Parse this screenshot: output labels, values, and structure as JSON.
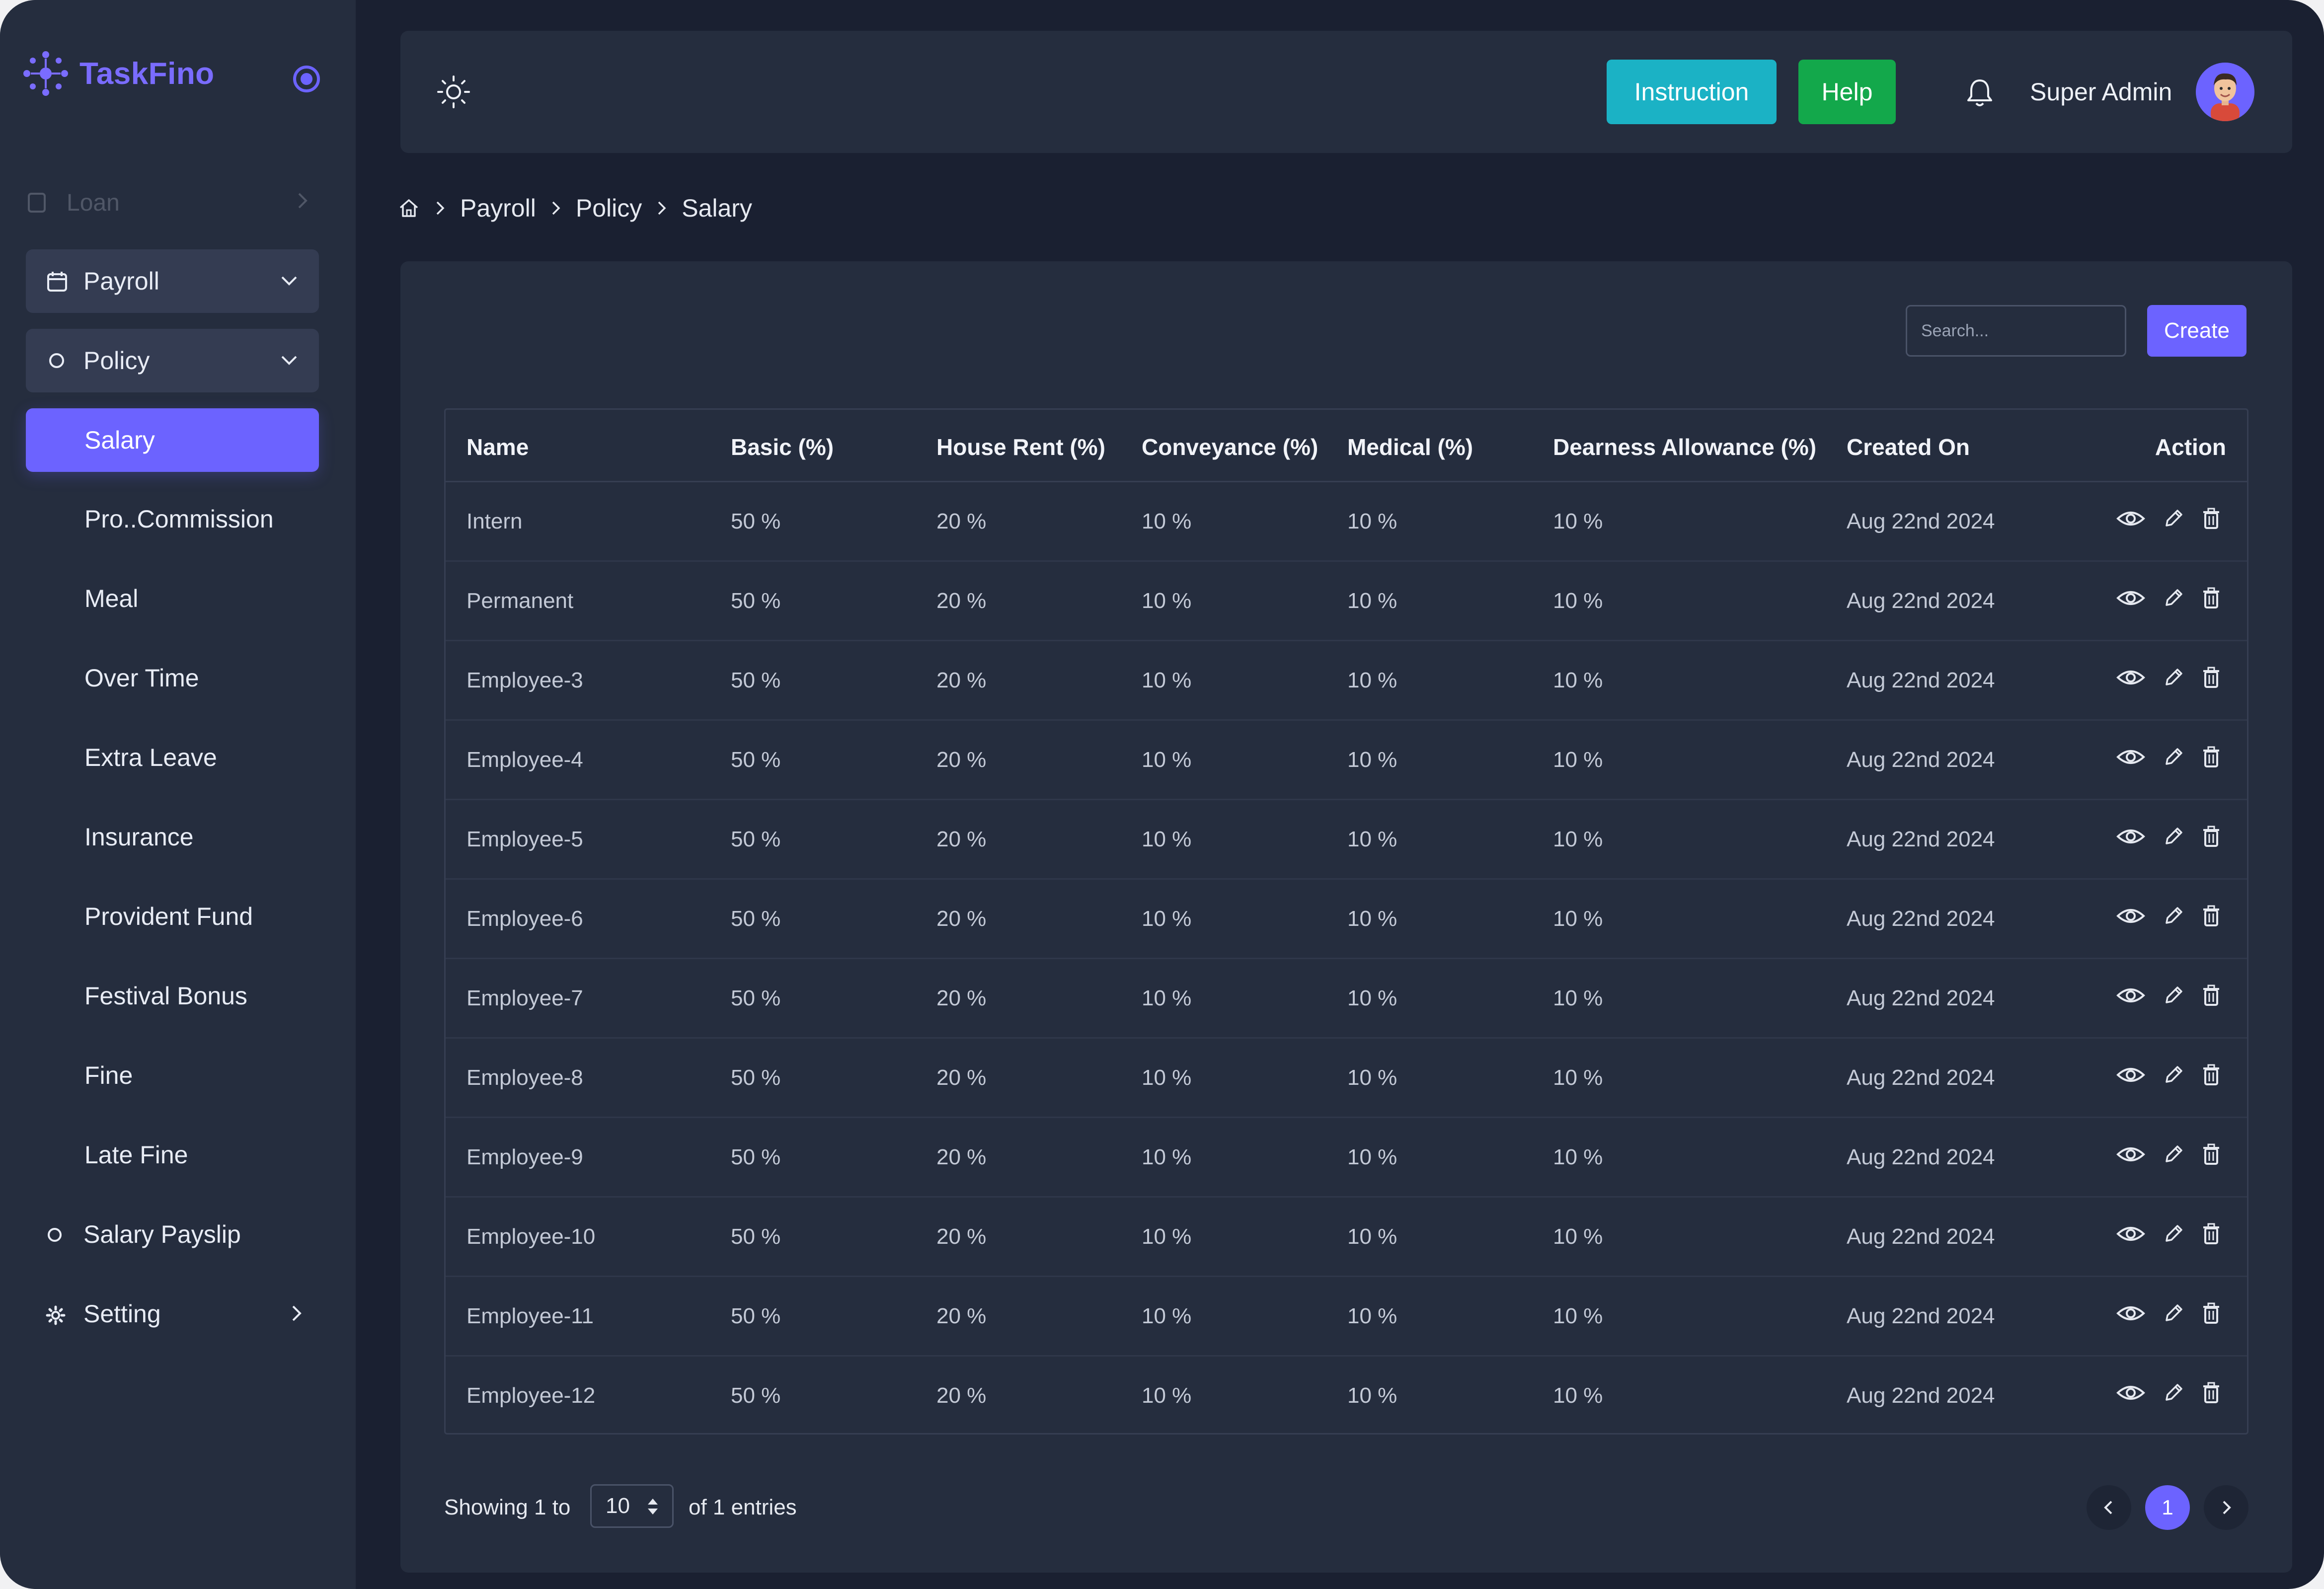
{
  "app": {
    "name": "TaskFino",
    "brand_color": "#6c63ff"
  },
  "sidebar": {
    "faded_item": {
      "label": "Loan",
      "icon": "file-icon"
    },
    "payroll": {
      "label": "Payroll",
      "icon": "calendar-icon"
    },
    "policy": {
      "label": "Policy",
      "icon": "circle-icon"
    },
    "active_item": {
      "label": "Salary"
    },
    "sub_items": [
      "Pro..Commission",
      "Meal",
      "Over Time",
      "Extra Leave",
      "Insurance",
      "Provident Fund",
      "Festival Bonus",
      "Fine",
      "Late Fine"
    ],
    "salary_payslip": {
      "label": "Salary Payslip",
      "icon": "circle-icon"
    },
    "setting": {
      "label": "Setting",
      "icon": "gear-icon"
    }
  },
  "header": {
    "instruction_label": "Instruction",
    "help_label": "Help",
    "user_name": "Super Admin",
    "instruction_color": "#1bb2c5",
    "help_color": "#13a84b"
  },
  "breadcrumb": [
    "Payroll",
    "Policy",
    "Salary"
  ],
  "toolbar": {
    "search_placeholder": "Search...",
    "create_label": "Create"
  },
  "table": {
    "columns": [
      "Name",
      "Basic (%)",
      "House Rent (%)",
      "Conveyance (%)",
      "Medical (%)",
      "Dearness Allowance (%)",
      "Created On",
      "Action"
    ],
    "rows": [
      [
        "Intern",
        "50 %",
        "20 %",
        "10 %",
        "10 %",
        "10 %",
        "Aug 22nd 2024"
      ],
      [
        "Permanent",
        "50 %",
        "20 %",
        "10 %",
        "10 %",
        "10 %",
        "Aug 22nd 2024"
      ],
      [
        "Employee-3",
        "50 %",
        "20 %",
        "10 %",
        "10 %",
        "10 %",
        "Aug 22nd 2024"
      ],
      [
        "Employee-4",
        "50 %",
        "20 %",
        "10 %",
        "10 %",
        "10 %",
        "Aug 22nd 2024"
      ],
      [
        "Employee-5",
        "50 %",
        "20 %",
        "10 %",
        "10 %",
        "10 %",
        "Aug 22nd 2024"
      ],
      [
        "Employee-6",
        "50 %",
        "20 %",
        "10 %",
        "10 %",
        "10 %",
        "Aug 22nd 2024"
      ],
      [
        "Employee-7",
        "50 %",
        "20 %",
        "10 %",
        "10 %",
        "10 %",
        "Aug 22nd 2024"
      ],
      [
        "Employee-8",
        "50 %",
        "20 %",
        "10 %",
        "10 %",
        "10 %",
        "Aug 22nd 2024"
      ],
      [
        "Employee-9",
        "50 %",
        "20 %",
        "10 %",
        "10 %",
        "10 %",
        "Aug 22nd 2024"
      ],
      [
        "Employee-10",
        "50 %",
        "20 %",
        "10 %",
        "10 %",
        "10 %",
        "Aug 22nd 2024"
      ],
      [
        "Employee-11",
        "50 %",
        "20 %",
        "10 %",
        "10 %",
        "10 %",
        "Aug 22nd 2024"
      ],
      [
        "Employee-12",
        "50 %",
        "20 %",
        "10 %",
        "10 %",
        "10 %",
        "Aug 22nd 2024"
      ]
    ],
    "row_action_icons": [
      "eye-icon",
      "pencil-icon",
      "trash-icon"
    ]
  },
  "footer": {
    "showing_label": "Showing 1 to",
    "per_page": "10",
    "entries_label": "of 1 entries",
    "current_page": "1"
  }
}
